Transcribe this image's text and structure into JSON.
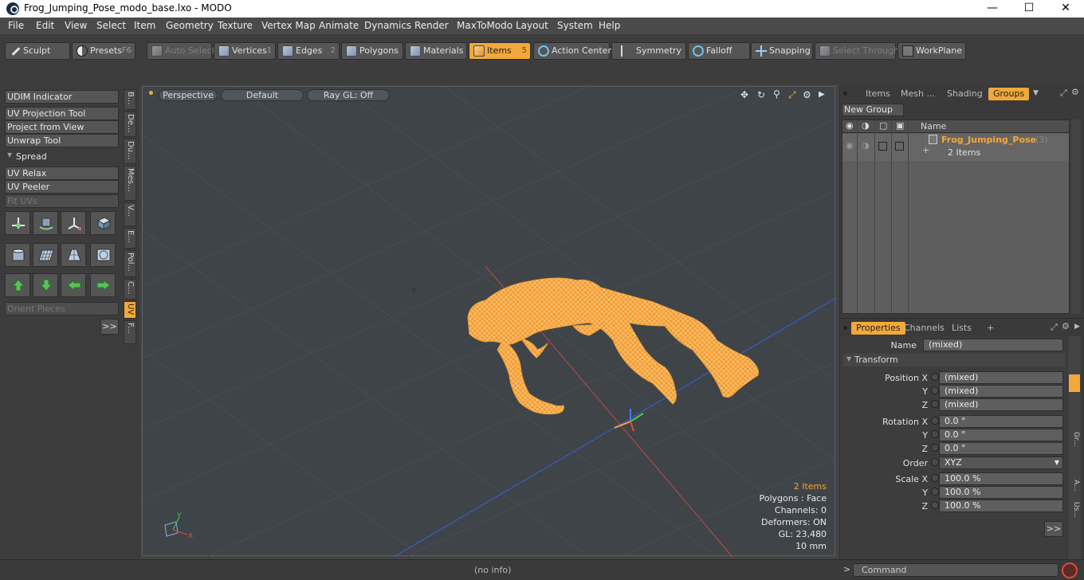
{
  "window": {
    "title": "Frog_Jumping_Pose_modo_base.lxo - MODO"
  },
  "menu": [
    "File",
    "Edit",
    "View",
    "Select",
    "Item",
    "Geometry",
    "Texture",
    "Vertex Map",
    "Animate",
    "Dynamics",
    "Render",
    "MaxToModo",
    "Layout",
    "System",
    "Help"
  ],
  "toolbar": {
    "sculpt": "Sculpt",
    "presets": "Presets",
    "presets_key": "F6",
    "auto_select": "Auto Select",
    "vertices": "Vertices",
    "vertices_key": "1",
    "edges": "Edges",
    "edges_key": "2",
    "polygons": "Polygons",
    "materials": "Materials",
    "items": "Items",
    "items_key": "5",
    "action_center": "Action Center",
    "symmetry": "Symmetry",
    "falloff": "Falloff",
    "snapping": "Snapping",
    "select_through": "Select Through",
    "workplane": "WorkPlane"
  },
  "left": {
    "udim": "UDIM Indicator",
    "uv_projection": "UV Projection Tool",
    "project_view": "Project from View",
    "unwrap": "Unwrap Tool",
    "spread": "Spread",
    "uv_relax": "UV Relax",
    "uv_peeler": "UV Peeler",
    "fit_uvs": "Fit UVs",
    "orient": "Orient Pieces",
    "more": ">>",
    "tabs": [
      "B...",
      "De...",
      "Du...",
      "Mes...",
      "V...",
      "E...",
      "Pol...",
      "C...",
      "UV",
      "F..."
    ]
  },
  "viewport": {
    "perspective": "Perspective",
    "default": "Default",
    "raygl": "Ray GL: Off",
    "info": {
      "items": "2 Items",
      "polygons": "Polygons : Face",
      "channels": "Channels: 0",
      "deformers": "Deformers: ON",
      "gl": "GL: 23,480",
      "scale": "10 mm"
    },
    "axis_y": "Y",
    "axis_x": "X"
  },
  "groups": {
    "tabs": [
      "Items",
      "Mesh ...",
      "Shading",
      "Groups"
    ],
    "new_group": "New Group",
    "col_name": "Name",
    "row_name": "Frog_Jumping_Pose",
    "row_count": "(3)",
    "row_sub": "2 Items"
  },
  "props": {
    "tabs": [
      "Properties",
      "Channels",
      "Lists",
      "+"
    ],
    "name_label": "Name",
    "name_value": "(mixed)",
    "transform": "Transform",
    "pos_x_label": "Position X",
    "pos_x": "(mixed)",
    "pos_y_label": "Y",
    "pos_y": "(mixed)",
    "pos_z_label": "Z",
    "pos_z": "(mixed)",
    "rot_x_label": "Rotation X",
    "rot_x": "0.0 °",
    "rot_y_label": "Y",
    "rot_y": "0.0 °",
    "rot_z_label": "Z",
    "rot_z": "0.0 °",
    "order_label": "Order",
    "order": "XYZ",
    "scl_x_label": "Scale X",
    "scl_x": "100.0 %",
    "scl_y_label": "Y",
    "scl_y": "100.0 %",
    "scl_z_label": "Z",
    "scl_z": "100.0 %",
    "more": ">>",
    "side_tabs": [
      "Gr...",
      "A...",
      "Us..."
    ]
  },
  "status": {
    "info": "(no info)",
    "prompt": ">",
    "command": "Command"
  },
  "colors": {
    "accent": "#f2a83a",
    "mesh": "#f5a23a",
    "viewport_bg": "#3f4449"
  }
}
